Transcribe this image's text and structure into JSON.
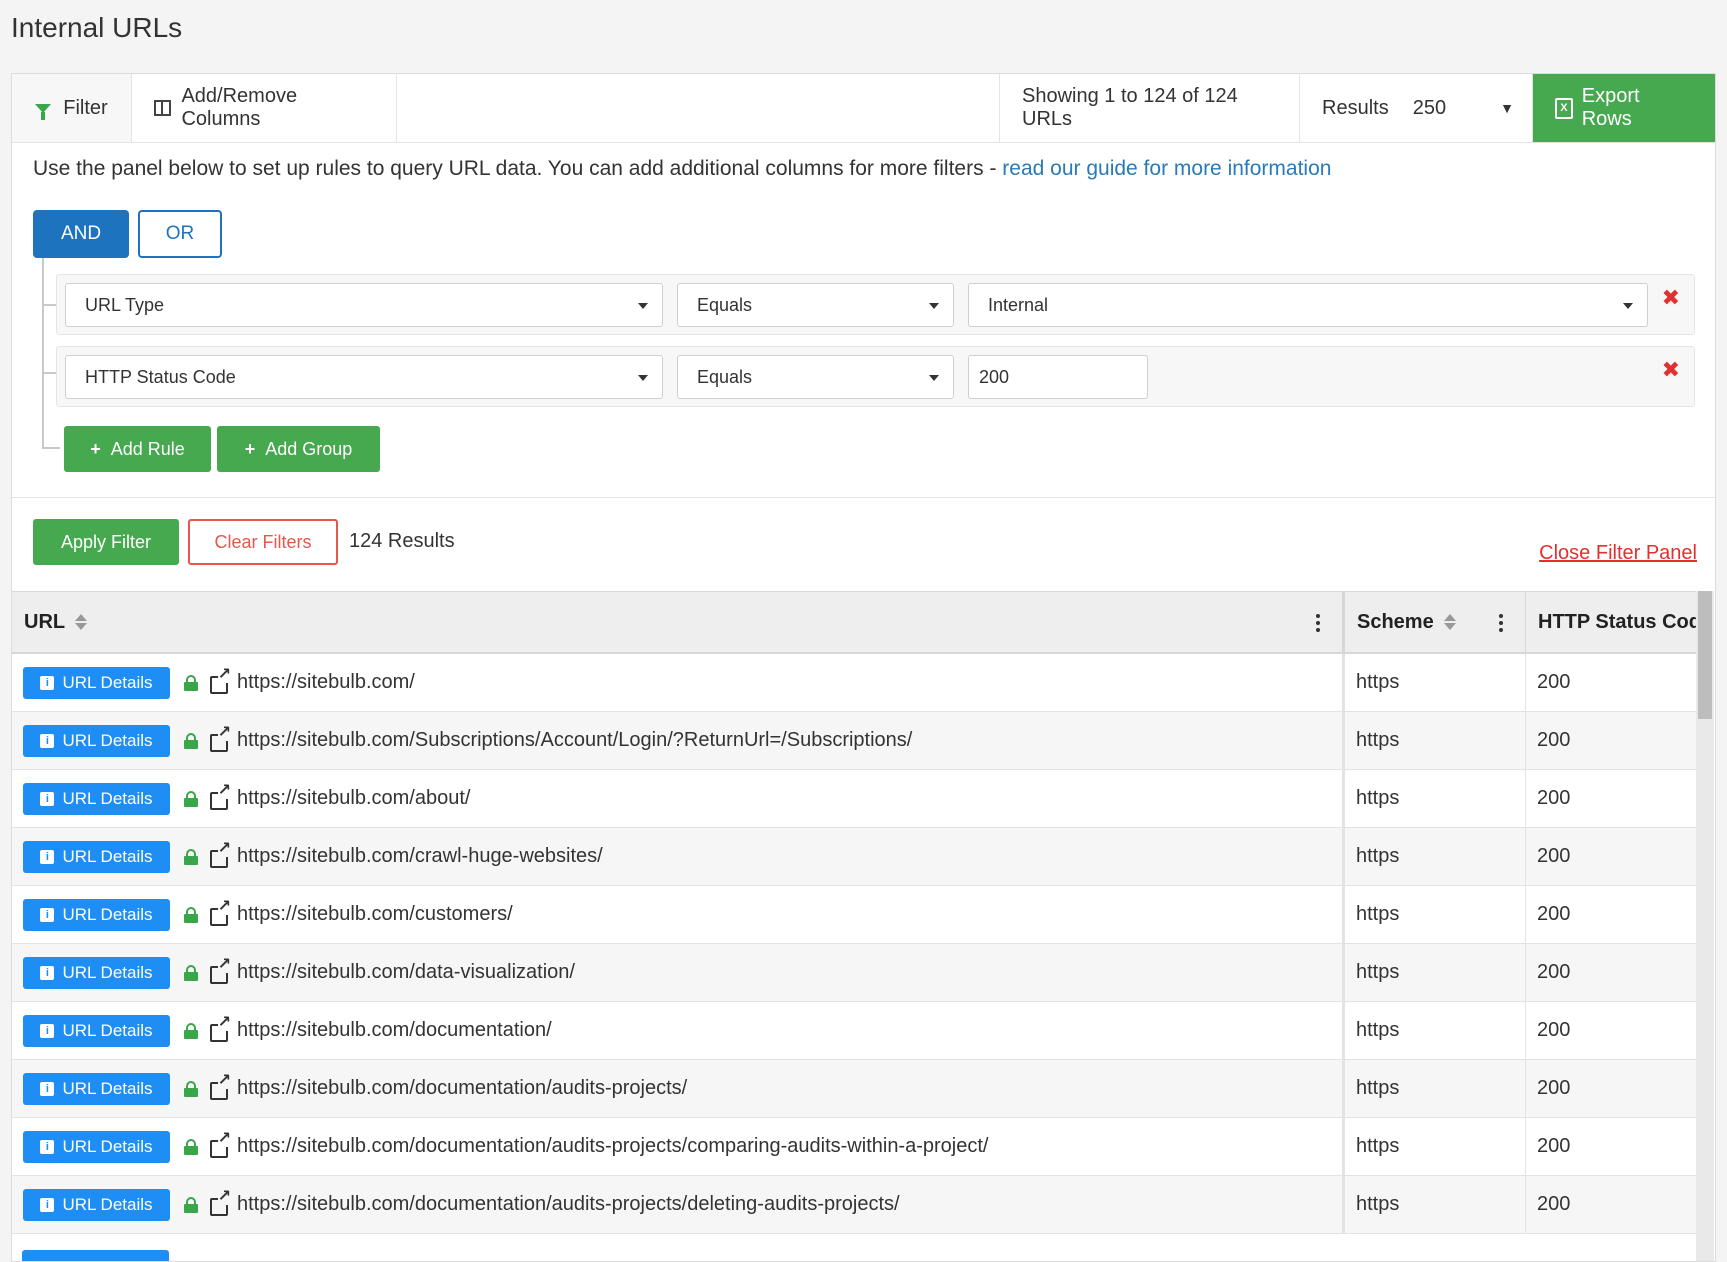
{
  "page": {
    "title": "Internal URLs"
  },
  "toolbar": {
    "filter_label": "Filter",
    "columns_label": "Add/Remove Columns",
    "showing_text": "Showing 1 to 124 of 124 URLs",
    "results_label": "Results",
    "results_value": "250",
    "export_label": "Export Rows"
  },
  "filter": {
    "help_text": "Use the panel below to set up rules to query URL data. You can add additional columns for more filters - ",
    "help_link": "read our guide for more information",
    "and_label": "AND",
    "or_label": "OR",
    "rules": [
      {
        "field": "URL Type",
        "operator": "Equals",
        "value": "Internal"
      },
      {
        "field": "HTTP Status Code",
        "operator": "Equals",
        "value": "200"
      }
    ],
    "add_rule_label": "Add Rule",
    "add_group_label": "Add Group",
    "apply_label": "Apply Filter",
    "clear_label": "Clear Filters",
    "results_count": "124 Results",
    "close_label": "Close Filter Panel"
  },
  "grid": {
    "columns": [
      "URL",
      "Scheme",
      "HTTP Status Cod"
    ],
    "details_label": "URL Details",
    "rows": [
      {
        "url": "https://sitebulb.com/",
        "scheme": "https",
        "status": "200"
      },
      {
        "url": "https://sitebulb.com/Subscriptions/Account/Login/?ReturnUrl=/Subscriptions/",
        "scheme": "https",
        "status": "200"
      },
      {
        "url": "https://sitebulb.com/about/",
        "scheme": "https",
        "status": "200"
      },
      {
        "url": "https://sitebulb.com/crawl-huge-websites/",
        "scheme": "https",
        "status": "200"
      },
      {
        "url": "https://sitebulb.com/customers/",
        "scheme": "https",
        "status": "200"
      },
      {
        "url": "https://sitebulb.com/data-visualization/",
        "scheme": "https",
        "status": "200"
      },
      {
        "url": "https://sitebulb.com/documentation/",
        "scheme": "https",
        "status": "200"
      },
      {
        "url": "https://sitebulb.com/documentation/audits-projects/",
        "scheme": "https",
        "status": "200"
      },
      {
        "url": "https://sitebulb.com/documentation/audits-projects/comparing-audits-within-a-project/",
        "scheme": "https",
        "status": "200"
      },
      {
        "url": "https://sitebulb.com/documentation/audits-projects/deleting-audits-projects/",
        "scheme": "https",
        "status": "200"
      }
    ]
  },
  "colors": {
    "green": "#46a84f",
    "blue": "#1e73be",
    "details_blue": "#1e8ef5",
    "red": "#e03131"
  }
}
